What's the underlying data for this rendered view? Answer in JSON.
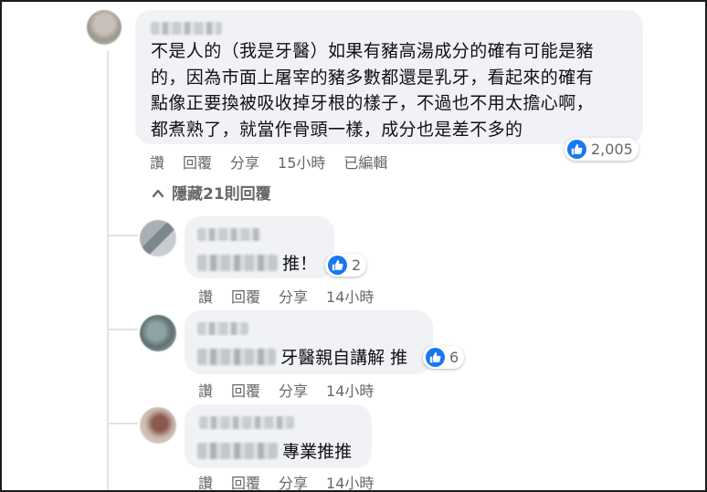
{
  "comment": {
    "lines": [
      "不是人的（我是牙醫）如果有豬高湯成分的確有可能是豬",
      "的，因為市面上屠宰的豬多數都還是乳牙，看起來的確有",
      "點像正要換被吸收掉牙根的樣子，不過也不用太擔心啊，",
      "都煮熟了，就當作骨頭一樣，成分也是差不多的"
    ],
    "actions": {
      "like": "讚",
      "reply": "回覆",
      "share": "分享",
      "time": "15小時",
      "edited": "已編輯"
    },
    "reaction_count": "2,005",
    "hide_replies": "隱藏21則回覆"
  },
  "replies": [
    {
      "text": "推！",
      "reaction_count": "2",
      "actions": {
        "like": "讚",
        "reply": "回覆",
        "share": "分享",
        "time": "14小時"
      }
    },
    {
      "text": "牙醫親自講解 推",
      "reaction_count": "6",
      "actions": {
        "like": "讚",
        "reply": "回覆",
        "share": "分享",
        "time": "14小時"
      }
    },
    {
      "text": "專業推推",
      "actions": {
        "like": "讚",
        "reply": "回覆",
        "share": "分享",
        "time": "14小時"
      }
    }
  ],
  "colors": {
    "like_blue": "#1877f2",
    "bubble_bg": "#f0f2f5",
    "meta_gray": "#65676b"
  },
  "icons": {
    "like": "thumbs-up-icon",
    "collapse": "chevron-up-icon"
  }
}
